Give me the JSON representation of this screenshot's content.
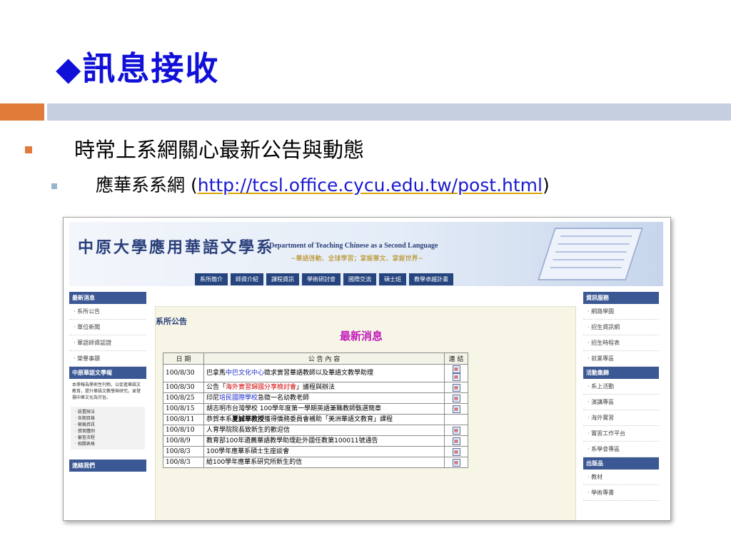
{
  "slide": {
    "title": "◆訊息接收",
    "bullet1": "時常上系網關心最新公告與動態",
    "bullet2_prefix": "應華系系網",
    "bullet2_open": " (",
    "bullet2_url": "http://tcsl.office.cycu.edu.tw/post.html",
    "bullet2_close": ")"
  },
  "colors": {
    "title": "#1010d8",
    "accent_orange": "#e07b39",
    "band_blue": "#c5cfe0",
    "link_blue": "#1a1ad0"
  },
  "site": {
    "name_cn": "中原大學應用華語文學系",
    "name_en": "Department of Teaching Chinese as a Second Language",
    "slogan": "~華語啓動、全球學習；掌握華文、掌握世界~",
    "nav": [
      "系所簡介",
      "師資介紹",
      "課程資訊",
      "學術研討會",
      "國際交流",
      "碩士班",
      "教學卓越計畫"
    ],
    "left": {
      "news_header": "最新消息",
      "news_links": [
        "· 系所公告",
        "· 單位新聞",
        "· 華語師資認證",
        "· 榮譽事蹟"
      ],
      "journal_header": "中原華語文學報",
      "journal_blurb": "本學報為學術性刊物，以促進華語文教育，提升華語文教學與研究，並發揚中華文化為宗旨。",
      "journal_links": [
        "· 設置辦法",
        "· 各期目錄",
        "· 徵稿資訊",
        "· 撰寫體例",
        "· 審查流程",
        "· 相關表格"
      ],
      "contact_header": "連絡我們"
    },
    "right": {
      "info_header": "資訊服務",
      "info_links": [
        "· 網路學園",
        "· 招生資訊網",
        "· 招生時程表",
        "· 就業專區"
      ],
      "activity_header": "活動集錦",
      "activity_links": [
        "· 系上活動",
        "· 演講專區",
        "· 海外實習",
        "· 實習工作平台",
        "· 系學會專區"
      ],
      "pub_header": "出版品",
      "pub_links": [
        "· 教材",
        "· 學術專書"
      ]
    },
    "center": {
      "section_title": "系所公告",
      "news_title": "最新消息",
      "table_headers": [
        "日 期",
        "公 告 內 容",
        "連 結"
      ],
      "rows": [
        {
          "date": "100/8/30",
          "pre": "巴拿馬",
          "hl": "中巴文化中心",
          "post": "徵求實習華語教師以及華語文教學助理",
          "links": 2
        },
        {
          "date": "100/8/30",
          "pre": "公告「",
          "hl": "海外實習歸國分享檢討會",
          "post": "」議程與辦法",
          "links": 1
        },
        {
          "date": "100/8/25",
          "pre": "印尼",
          "hl": "培民國際學校",
          "post": "急徵一名幼教老師",
          "links": 1
        },
        {
          "date": "100/8/15",
          "pre": "",
          "hl": "",
          "post": "胡志明市台灣學校 100學年度第一學期英語兼職教師甄選簡章",
          "links": 1
        },
        {
          "date": "100/8/11",
          "pre": "恭賀本系",
          "hl": "夏誠華教授",
          "post": "獲得僑務委員會補助「美洲華語文教育」課程",
          "links": 0
        },
        {
          "date": "100/8/10",
          "pre": "",
          "hl": "",
          "post": "人育學院院長致新生的歡迎信",
          "links": 1
        },
        {
          "date": "100/8/9",
          "pre": "",
          "hl": "",
          "post": "教育部100年遴薦華語教學助理赴外國任教第100011號通告",
          "links": 1
        },
        {
          "date": "100/8/3",
          "pre": "",
          "hl": "",
          "post": "100學年應華系碩士生座談會",
          "links": 1
        },
        {
          "date": "100/8/3",
          "pre": "",
          "hl": "",
          "post": "給100學年應華系研究所新生的信",
          "links": 1
        }
      ]
    }
  }
}
